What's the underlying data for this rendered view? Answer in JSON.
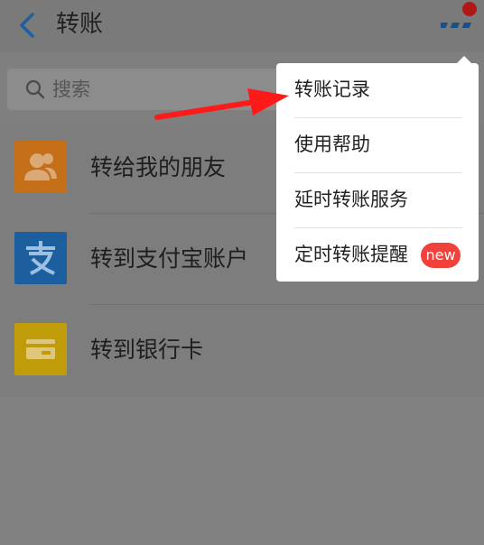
{
  "header": {
    "title": "转账"
  },
  "search": {
    "placeholder": "搜索"
  },
  "list": {
    "items": [
      {
        "label": "转给我的朋友",
        "icon": "friends-icon",
        "color": "#d4761a"
      },
      {
        "label": "转到支付宝账户",
        "icon": "alipay-icon",
        "color": "#1f6dbb"
      },
      {
        "label": "转到银行卡",
        "icon": "bank-card-icon",
        "color": "#c9a20b"
      }
    ]
  },
  "menu": {
    "items": [
      {
        "label": "转账记录"
      },
      {
        "label": "使用帮助"
      },
      {
        "label": "延时转账服务"
      },
      {
        "label": "定时转账提醒",
        "badge": "new"
      }
    ]
  },
  "colors": {
    "accent": "#1f6dbb",
    "badge": "#f0413a",
    "annotation_arrow": "#ff1a1a"
  }
}
